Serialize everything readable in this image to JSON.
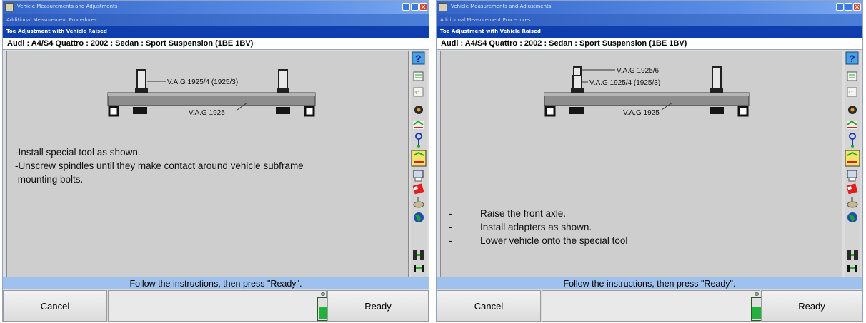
{
  "windows": [
    {
      "id": "left",
      "window_title": "Vehicle Measurements and Adjustments",
      "subheader": "Additional Measurement Procedures",
      "procedure_title": "Toe Adjustment with Vehicle Raised",
      "vehicle": "Audi : A4/S4 Quattro : 2002 : Sedan : Sport Suspension (1BE 1BV)",
      "diagram_labels": [
        "V.A.G 1925/4 (1925/3)",
        "V.A.G 1925"
      ],
      "instructions": [
        "-Install special tool as shown.",
        "-Unscrew spindles until they make contact around vehicle subframe",
        " mounting bolts."
      ],
      "status": "Follow the instructions, then press \"Ready\".",
      "softkeys": {
        "cancel": "Cancel",
        "ready": "Ready"
      },
      "level_fill": 0.6
    },
    {
      "id": "right",
      "window_title": "Vehicle Measurements and Adjustments",
      "subheader": "Additional Measurement Procedures",
      "procedure_title": "Toe Adjustment with Vehicle Raised",
      "vehicle": "Audi : A4/S4 Quattro : 2002 : Sedan : Sport Suspension (1BE 1BV)",
      "diagram_labels": [
        "V.A.G 1925/6",
        "V.A.G 1925/4 (1925/3)",
        "V.A.G 1925"
      ],
      "instructions": [
        {
          "dash": "-",
          "text": "Raise the front axle."
        },
        {
          "dash": "-",
          "text": "Install adapters as shown."
        },
        {
          "dash": "-",
          "text": "Lower vehicle onto the special tool"
        }
      ],
      "status": "Follow the instructions, then press \"Ready\".",
      "softkeys": {
        "cancel": "Cancel",
        "ready": "Ready"
      },
      "level_fill": 0.6
    }
  ],
  "toolbar_icons": [
    "help-icon",
    "specs-icon",
    "measure-icon",
    "wheel-icon",
    "adjust-icon",
    "caster-icon",
    "active-procedure-icon",
    "print-icon",
    "flag-icon",
    "tools-icon",
    "globe-icon",
    "alignment-indicator-icon",
    "toe-indicator-icon"
  ],
  "colors": {
    "title_bar": "#3466c8",
    "procedure_bar": "#0f3fae",
    "status_bar": "#9fc1ee",
    "content_bg": "#cecece",
    "level_green": "#22b13c"
  }
}
